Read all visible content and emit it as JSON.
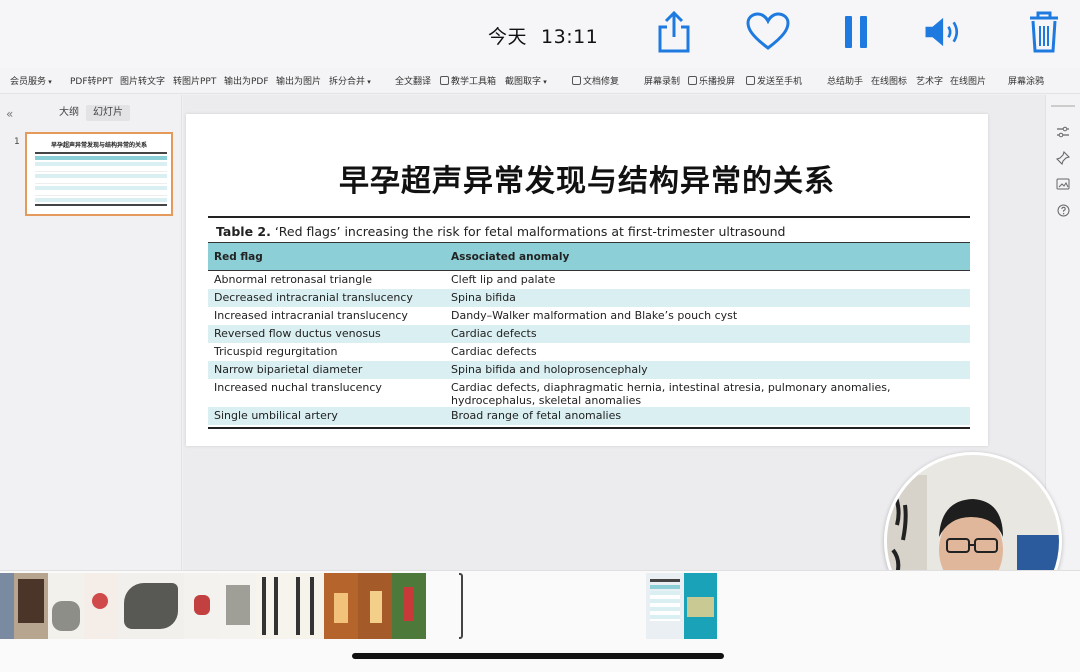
{
  "topbar": {
    "date_label": "今天",
    "time": "13:11",
    "icons": [
      "share-icon",
      "heart-icon",
      "pause-icon",
      "volume-icon",
      "trash-icon"
    ]
  },
  "ribbon": {
    "items": [
      {
        "label": "会员服务",
        "dropdown": true
      },
      {
        "label": "PDF转PPT"
      },
      {
        "label": "图片转文字"
      },
      {
        "label": "转图片PPT"
      },
      {
        "label": "输出为PDF"
      },
      {
        "label": "输出为图片"
      },
      {
        "label": "拆分合并",
        "dropdown": true
      },
      {
        "label": "全文翻译"
      },
      {
        "label": "教学工具箱"
      },
      {
        "label": "截图取字",
        "dropdown": true
      },
      {
        "label": "文档修复"
      },
      {
        "label": "屏幕录制"
      },
      {
        "label": "乐播投屏"
      },
      {
        "label": "发送至手机"
      },
      {
        "label": "总结助手"
      },
      {
        "label": "在线图标"
      },
      {
        "label": "艺术字"
      },
      {
        "label": "在线图片"
      },
      {
        "label": "屏幕涂鸦"
      }
    ]
  },
  "leftpanel": {
    "collapse_glyph": "«",
    "tabs": [
      {
        "label": "大纲"
      },
      {
        "label": "幻灯片"
      }
    ],
    "slide_number": "1"
  },
  "slide": {
    "title": "早孕超声异常发现与结构异常的关系",
    "table": {
      "caption_bold": "Table 2.",
      "caption_rest": " ‘Red flags’ increasing the risk for fetal malformations at first-trimester ultrasound",
      "headers": [
        "Red flag",
        "Associated anomaly"
      ],
      "rows": [
        {
          "flag": "Abnormal retronasal triangle",
          "anomaly": "Cleft lip and palate"
        },
        {
          "flag": "Decreased intracranial translucency",
          "anomaly": "Spina bifida"
        },
        {
          "flag": "Increased intracranial translucency",
          "anomaly": "Dandy–Walker malformation and Blake’s pouch cyst"
        },
        {
          "flag": "Reversed flow ductus venosus",
          "anomaly": "Cardiac defects"
        },
        {
          "flag": "Tricuspid regurgitation",
          "anomaly": "Cardiac defects"
        },
        {
          "flag": "Narrow biparietal diameter",
          "anomaly": "Spina bifida and holoprosencephaly"
        },
        {
          "flag": "Increased nuchal translucency",
          "anomaly": "Cardiac defects, diaphragmatic hernia, intestinal atresia, pulmonary anomalies, hydrocephalus, skeletal anomalies"
        },
        {
          "flag": "Single umbilical artery",
          "anomaly": "Broad range of fetal anomalies"
        }
      ]
    }
  },
  "rightrail": {
    "icons": [
      "adjust-icon",
      "pin-icon",
      "image-icon",
      "help-icon"
    ]
  },
  "colors": {
    "table_header": "#8ccfd6",
    "table_stripe": "#d9eff2",
    "thumb_border": "#e49a5a",
    "accent_blue": "#1f7ae0"
  },
  "filmstrip": {
    "thumbnail_count": 12
  }
}
